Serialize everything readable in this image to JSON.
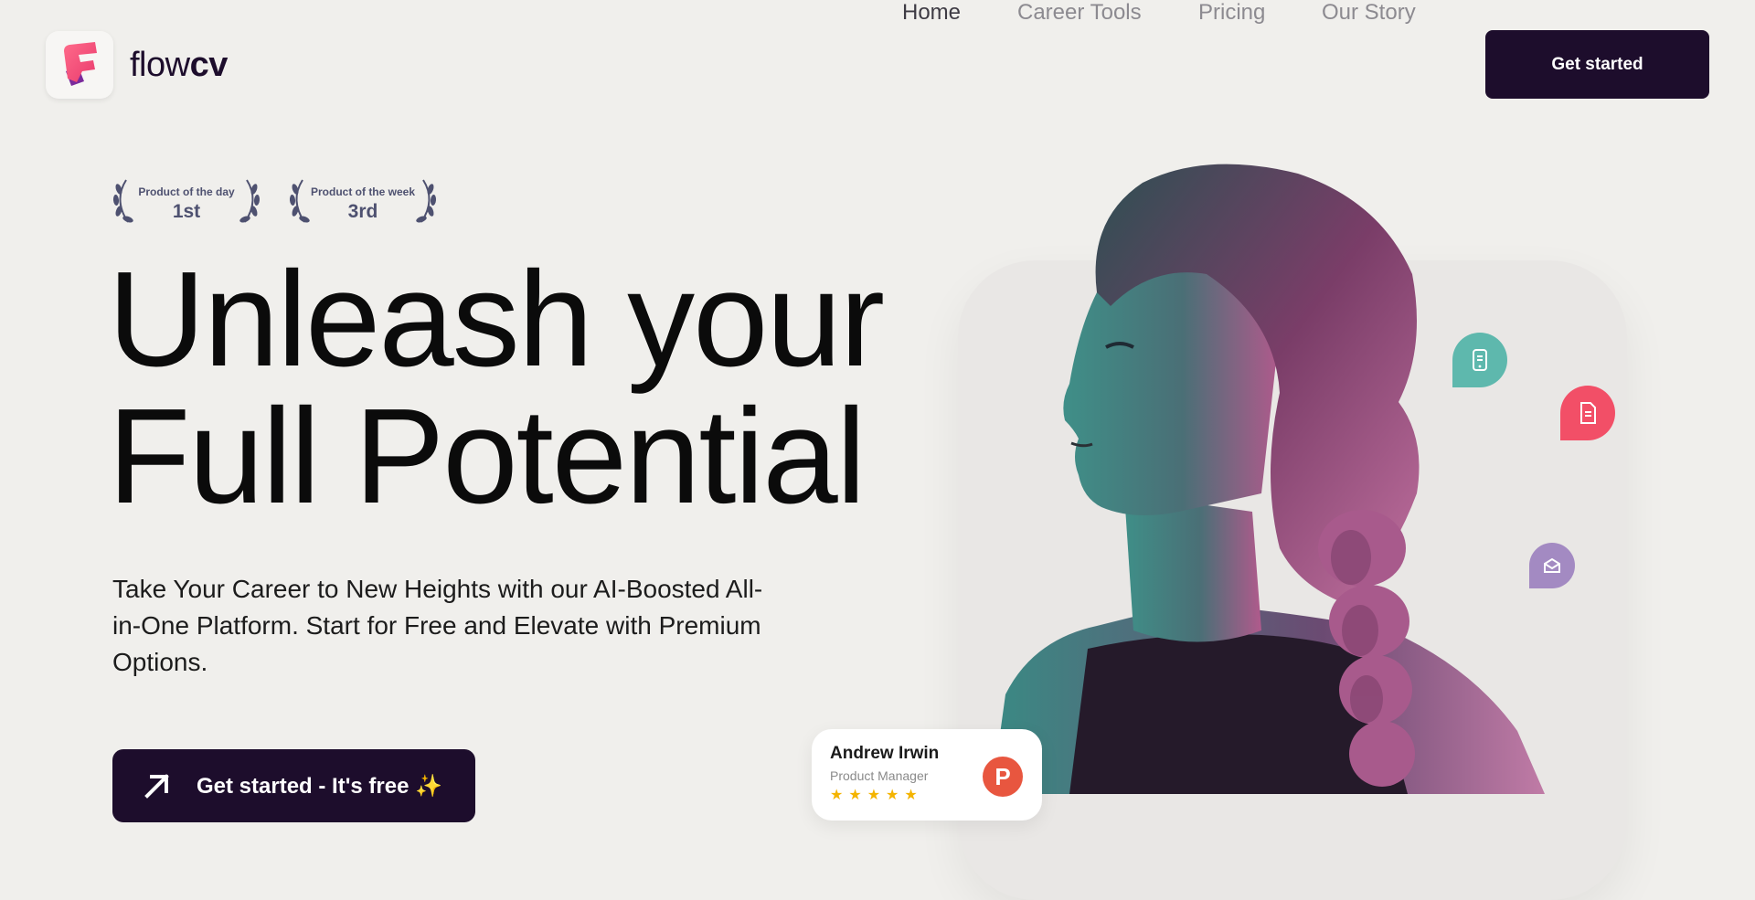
{
  "brand": {
    "name_light": "flow",
    "name_bold": "cv",
    "logo_colors": {
      "pink": "#f9527d",
      "purple": "#9b3bb2",
      "tile": "#f7f6f4"
    }
  },
  "nav": {
    "items": [
      {
        "label": "Home",
        "active": true
      },
      {
        "label": "Career Tools",
        "active": false
      },
      {
        "label": "Pricing",
        "active": false
      },
      {
        "label": "Our Story",
        "active": false
      }
    ],
    "cta_label": "Get started"
  },
  "badges": [
    {
      "label": "Product of the day",
      "rank": "1st"
    },
    {
      "label": "Product of the week",
      "rank": "3rd"
    }
  ],
  "hero": {
    "headline_line1": "Unleash your",
    "headline_line2": "Full Potential",
    "subtitle": "Take Your Career to New Heights with our AI-Boosted All-in-One Platform. Start for Free and Elevate with Premium Options.",
    "cta_label": "Get started - It's free ✨"
  },
  "bubbles": [
    {
      "icon": "phone-icon",
      "color": "#5eb8ad"
    },
    {
      "icon": "document-icon",
      "color": "#f24f67"
    },
    {
      "icon": "mail-icon",
      "color": "#a38ac2"
    }
  ],
  "review_card": {
    "name": "Andrew Irwin",
    "role": "Product Manager",
    "stars": "★★★★★",
    "source_letter": "P",
    "source_color": "#e8563f"
  },
  "colors": {
    "background": "#f0efec",
    "primary_dark": "#1d0d2c",
    "nav_text": "#8c8a90",
    "badge_text": "#4e5170"
  }
}
